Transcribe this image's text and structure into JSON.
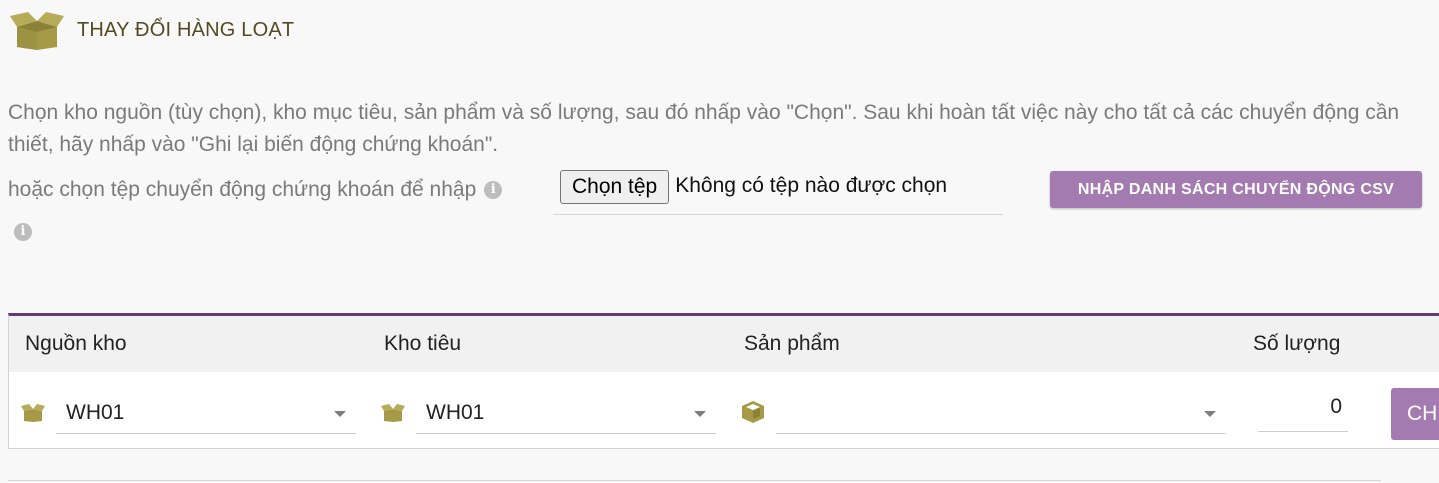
{
  "header": {
    "title": "THAY ĐỔI HÀNG LOẠT",
    "icon": "open-box-icon"
  },
  "description": {
    "text": "Chọn kho nguồn (tùy chọn), kho mục tiêu, sản phẩm và số lượng, sau đó nhấp vào \"Chọn\". Sau khi hoàn tất việc này cho tất cả các chuyển động cần thiết, hãy nhấp vào \"Ghi lại biến động chứng khoán\"."
  },
  "import": {
    "label": "hoặc chọn tệp chuyển động chứng khoán để nhập",
    "file_button": "Chọn tệp",
    "file_status": "Không có tệp nào được chọn",
    "csv_button": "NHẬP DANH SÁCH CHUYỂN ĐỘNG CSV",
    "info_icon_glyph": "i"
  },
  "table": {
    "headers": {
      "source": "Nguồn kho",
      "target": "Kho tiêu",
      "product": "Sản phẩm",
      "quantity": "Số lượng"
    },
    "row": {
      "source_value": "WH01",
      "target_value": "WH01",
      "product_value": "",
      "quantity_value": "0",
      "choose_button": "CH"
    }
  },
  "colors": {
    "accent": "#a37bb0",
    "header_border": "#5e3c74",
    "icon": "#a69a47",
    "title_text": "#524b22"
  }
}
